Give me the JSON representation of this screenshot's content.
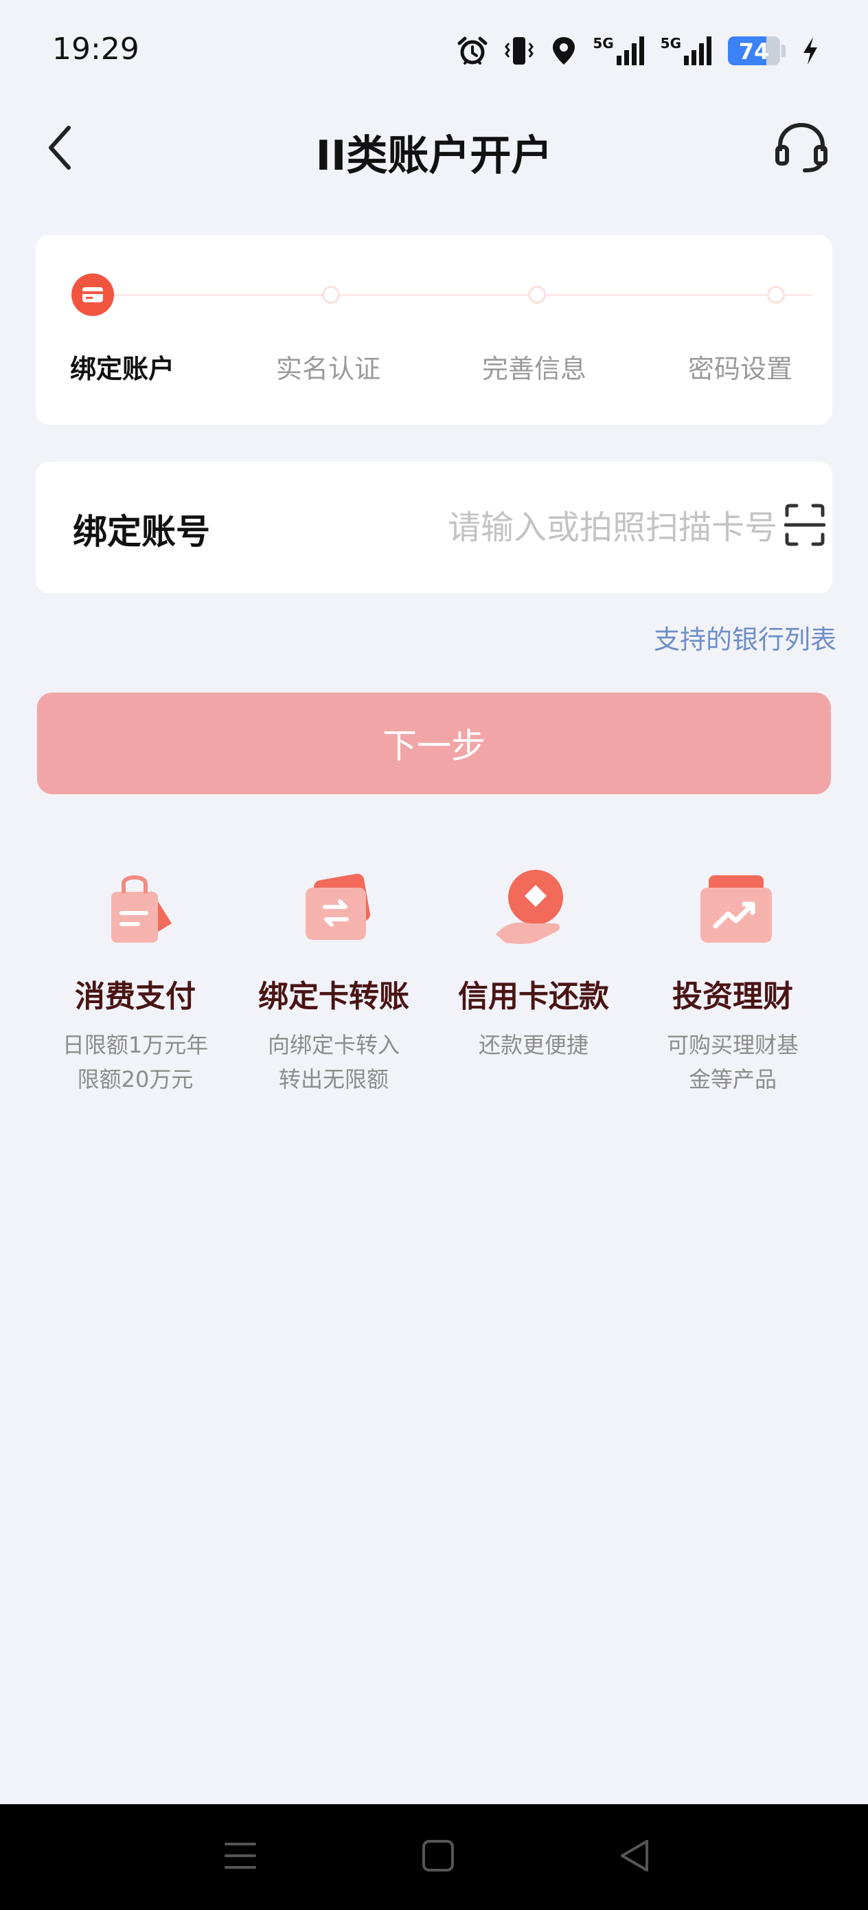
{
  "status_bar": {
    "time": "19:29",
    "network_1": "5G",
    "network_2": "5G",
    "battery_level": "74",
    "battery_fraction": 0.74,
    "icons": [
      "alarm-icon",
      "vibrate-icon",
      "location-icon",
      "signal-icon",
      "signal-icon",
      "battery-icon",
      "charging-icon"
    ]
  },
  "header": {
    "title": "II类账户开户",
    "back_icon": "back-arrow-icon",
    "service_icon": "headset-icon"
  },
  "steps": {
    "current_index": 0,
    "items": [
      {
        "label": "绑定账户"
      },
      {
        "label": "实名认证"
      },
      {
        "label": "完善信息"
      },
      {
        "label": "密码设置"
      }
    ]
  },
  "account_form": {
    "label": "绑定账号",
    "value": "",
    "placeholder": "请输入或拍照扫描卡号",
    "scan_icon": "scan-icon"
  },
  "bank_list_link": "支持的银行列表",
  "next_button": "下一步",
  "colors": {
    "accent": "#f2553f",
    "button_disabled": "#f1a5a6",
    "link": "#6e8ec6",
    "feature_title": "#4a1414"
  },
  "features": [
    {
      "title": "消费支付",
      "desc_line1": "日限额1万元年",
      "desc_line2": "限额20万元",
      "icon": "shopping-bag-icon"
    },
    {
      "title": "绑定卡转账",
      "desc_line1": "向绑定卡转入",
      "desc_line2": "转出无限额",
      "icon": "transfer-card-icon"
    },
    {
      "title": "信用卡还款",
      "desc_line1": "还款更便捷",
      "desc_line2": "",
      "icon": "repayment-hand-icon"
    },
    {
      "title": "投资理财",
      "desc_line1": "可购买理财基",
      "desc_line2": "金等产品",
      "icon": "investment-chart-icon"
    }
  ],
  "system_nav": {
    "icons": [
      "menu-icon",
      "home-icon",
      "back-icon"
    ]
  }
}
